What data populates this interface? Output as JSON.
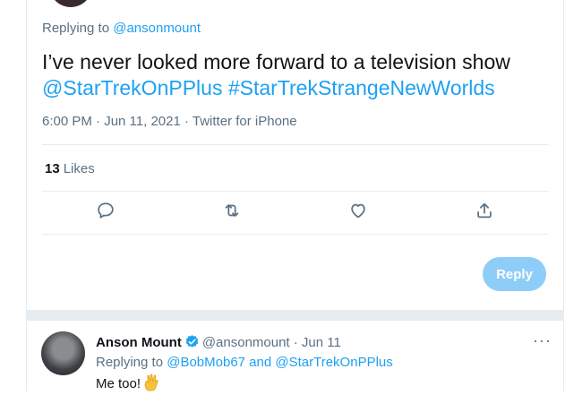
{
  "main_tweet": {
    "replying_prefix": "Replying to",
    "replying_handle": "@ansonmount",
    "text": "I’ve never looked more forward to a television show",
    "hashtag_1": "@StarTrekOnPPlus",
    "hashtag_2": "#StarTrekStrangeNewWorlds",
    "timestamp": "6:00 PM · Jun 11, 2021 · Twitter for iPhone",
    "likes_count": "13",
    "likes_label": "Likes"
  },
  "actions": {
    "reply_icon": "comment-icon",
    "retweet_icon": "retweet-icon",
    "like_icon": "heart-icon",
    "share_icon": "share-icon"
  },
  "reply_button": {
    "label": "Reply",
    "color": "#8ecdf8"
  },
  "reply": {
    "name": "Anson Mount",
    "handle_time": "@ansonmount · Jun 11",
    "more": "···",
    "replying_prefix": "Replying to",
    "mention_1": "@BobMob67",
    "and_word": "and",
    "mention_2": "@StarTrekOnPPlus",
    "text": "Me too!",
    "emoji": "vulcan-salute-icon"
  },
  "colors": {
    "accent": "#1da1f2",
    "secondary_text": "#5b7083",
    "divider": "#e6ecf0"
  }
}
